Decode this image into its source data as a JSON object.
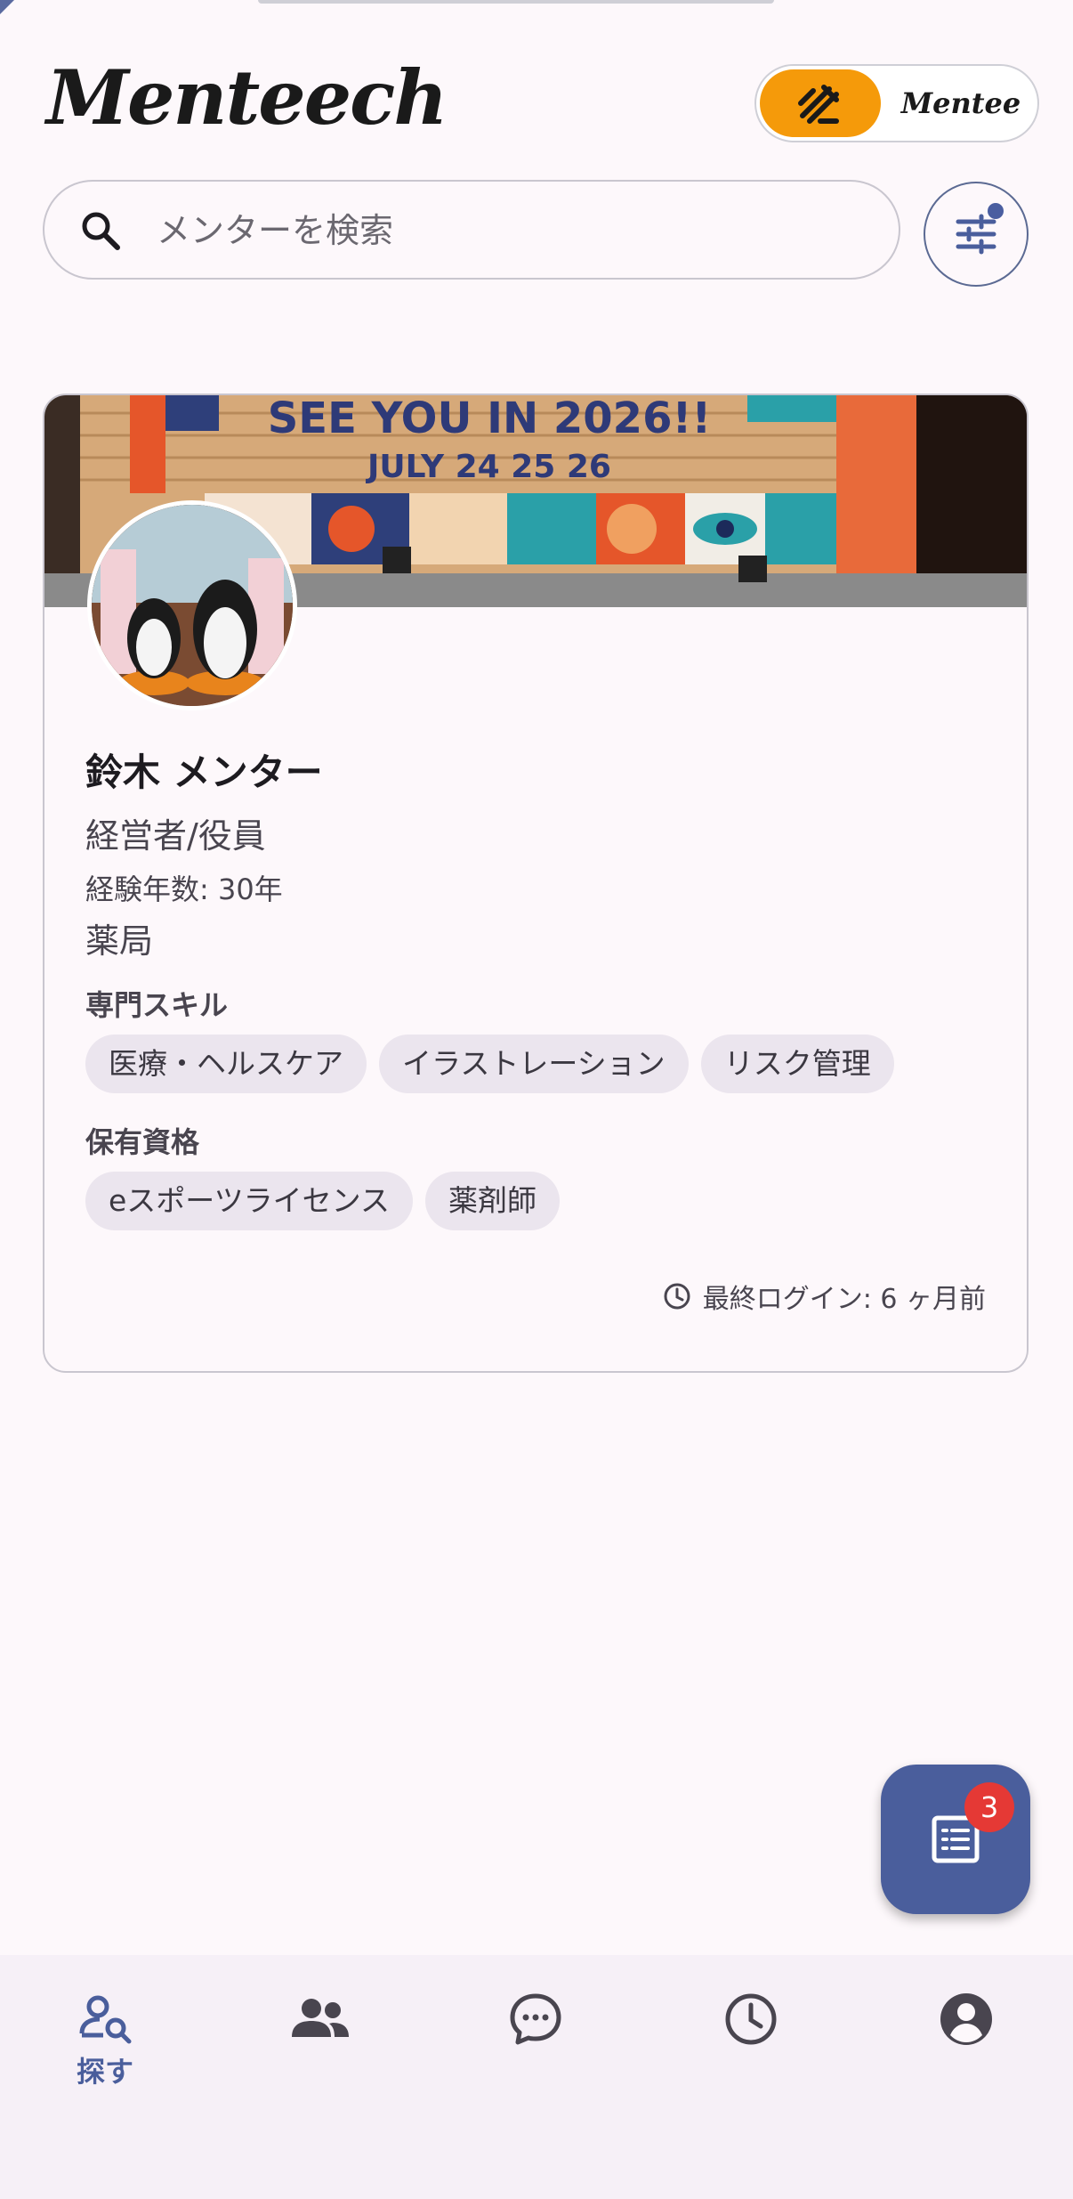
{
  "app": {
    "logo": "Menteech"
  },
  "mode_toggle": {
    "active_label": "",
    "inactive_label": "Mentee"
  },
  "search": {
    "placeholder": "メンターを検索"
  },
  "mentor": {
    "name": "鈴木 メンター",
    "role": "経営者/役員",
    "experience": "経験年数: 30年",
    "industry": "薬局",
    "skills_title": "専門スキル",
    "skills": [
      "医療・ヘルスケア",
      "イラストレーション",
      "リスク管理"
    ],
    "certs_title": "保有資格",
    "certs": [
      "eスポーツライセンス",
      "薬剤師"
    ],
    "last_login": "最終ログイン: 6 ヶ月前",
    "cover_banner": {
      "line1": "SEE YOU IN 2026!!",
      "line2": "JULY 24 25 26"
    }
  },
  "fab": {
    "badge": "3"
  },
  "bottom_nav": [
    {
      "icon": "search-person-icon",
      "label": "探す",
      "active": true
    },
    {
      "icon": "people-icon",
      "label": ""
    },
    {
      "icon": "chat-bubble-icon",
      "label": ""
    },
    {
      "icon": "history-clock-icon",
      "label": ""
    },
    {
      "icon": "account-circle-icon",
      "label": ""
    }
  ],
  "colors": {
    "accent": "#4a5e9c",
    "toggle_active": "#f59a0a",
    "badge": "#e53935",
    "background": "#fdf8fb"
  }
}
